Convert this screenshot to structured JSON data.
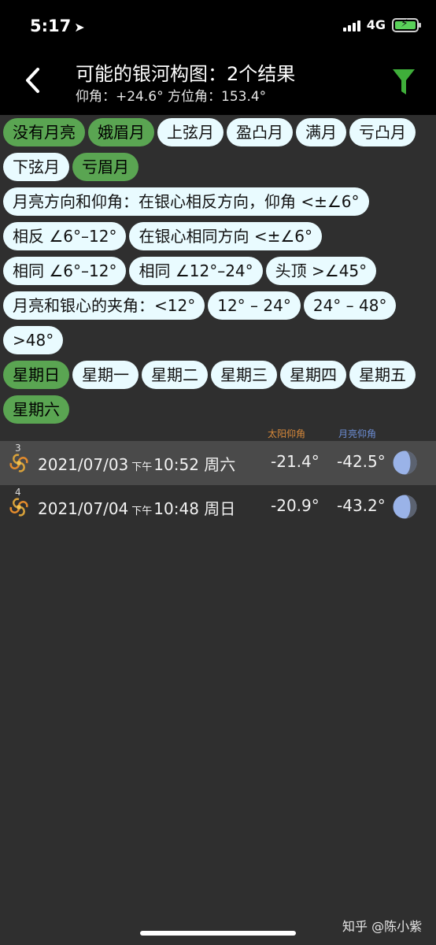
{
  "status": {
    "time": "5:17",
    "network": "4G"
  },
  "header": {
    "title": "可能的银河构图：2个结果",
    "subtitle": "仰角：+24.6° 方位角：153.4°"
  },
  "moon_phase_chips": [
    {
      "label": "没有月亮",
      "selected": true
    },
    {
      "label": "娥眉月",
      "selected": true
    },
    {
      "label": "上弦月",
      "selected": false
    },
    {
      "label": "盈凸月",
      "selected": false
    },
    {
      "label": "满月",
      "selected": false
    },
    {
      "label": "亏凸月",
      "selected": false
    },
    {
      "label": "下弦月",
      "selected": false
    },
    {
      "label": "亏眉月",
      "selected": true
    }
  ],
  "direction_chips": [
    {
      "label": "月亮方向和仰角：在银心相反方向，仰角 <±∠6°",
      "selected": false
    },
    {
      "label": "相反 ∠6°–12°",
      "selected": false
    },
    {
      "label": "在银心相同方向  <±∠6°",
      "selected": false
    },
    {
      "label": "相同 ∠6°–12°",
      "selected": false
    },
    {
      "label": "相同 ∠12°–24°",
      "selected": false
    },
    {
      "label": "头顶  >∠45°",
      "selected": false
    }
  ],
  "angle_chips": [
    {
      "label": "月亮和银心的夹角：<12°",
      "selected": false
    },
    {
      "label": "12° – 24°",
      "selected": false
    },
    {
      "label": "24° – 48°",
      "selected": false
    },
    {
      "label": ">48°",
      "selected": false
    }
  ],
  "weekday_chips": [
    {
      "label": "星期日",
      "selected": true
    },
    {
      "label": "星期一",
      "selected": false
    },
    {
      "label": "星期二",
      "selected": false
    },
    {
      "label": "星期三",
      "selected": false
    },
    {
      "label": "星期四",
      "selected": false
    },
    {
      "label": "星期五",
      "selected": false
    },
    {
      "label": "星期六",
      "selected": true
    }
  ],
  "columns": {
    "sun": "太阳仰角",
    "moon": "月亮仰角"
  },
  "results": [
    {
      "index": "3",
      "date": "2021/07/03",
      "ampm": "下午",
      "time": "10:52",
      "weekday": "周六",
      "sun": "-21.4°",
      "moon": "-42.5°"
    },
    {
      "index": "4",
      "date": "2021/07/04",
      "ampm": "下午",
      "time": "10:48",
      "weekday": "周日",
      "sun": "-20.9°",
      "moon": "-43.2°"
    }
  ],
  "watermark": "知乎 @陈小紫",
  "icons": {
    "back": "chevron-left-icon",
    "filter": "filter-icon",
    "galaxy": "galaxy-icon",
    "moon": "moon-phase-icon"
  },
  "colors": {
    "selected_chip": "#5aa552",
    "unselected_chip": "#e9fbff",
    "filter_icon": "#3fae3a",
    "sun_header": "#d8893a",
    "moon_header": "#6c8ed6"
  }
}
